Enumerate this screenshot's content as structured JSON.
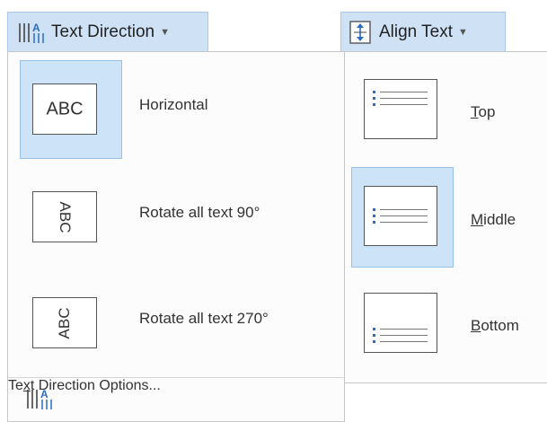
{
  "text_direction": {
    "button_label": "Text Direction",
    "items": [
      {
        "preview": "ABC",
        "label": "Horizontal",
        "selected": true
      },
      {
        "preview": "ABC",
        "label": "Rotate all text 90°",
        "selected": false
      },
      {
        "preview": "ABC",
        "label": "Rotate all text 270°",
        "selected": false
      }
    ],
    "options_label_before": "Te",
    "options_label_access": "x",
    "options_label_after": "t Direction Options..."
  },
  "align_text": {
    "button_label": "Align Text",
    "items": [
      {
        "access": "T",
        "rest": "op",
        "selected": false
      },
      {
        "access": "M",
        "rest": "iddle",
        "selected": true
      },
      {
        "access": "B",
        "rest": "ottom",
        "selected": false
      }
    ]
  },
  "colors": {
    "highlight": "#cde3f7",
    "icon_blue": "#2b6cc4"
  }
}
